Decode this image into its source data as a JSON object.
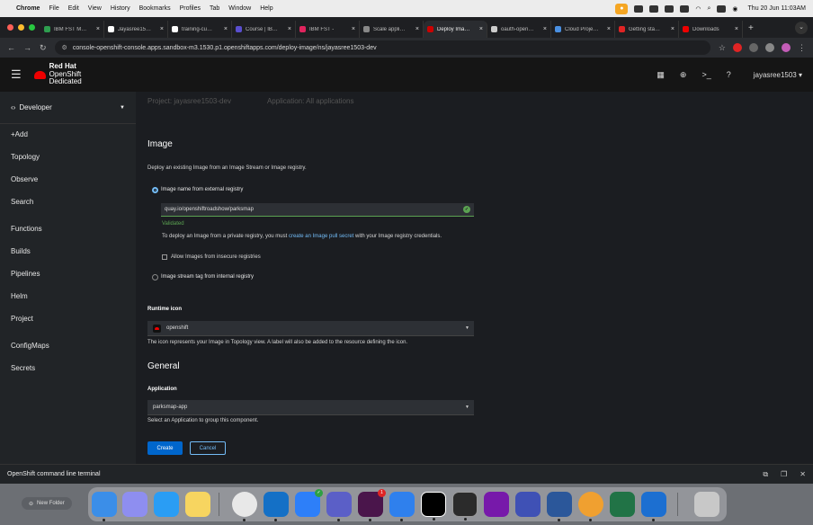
{
  "menubar": {
    "app": "Chrome",
    "items": [
      "File",
      "Edit",
      "View",
      "History",
      "Bookmarks",
      "Profiles",
      "Tab",
      "Window",
      "Help"
    ],
    "clock": "Thu 20 Jun  11:03AM"
  },
  "tabs": [
    {
      "label": "IBM FST M…",
      "color": "#2e9e4f"
    },
    {
      "label": "Jayasree15…",
      "color": "#ffffff"
    },
    {
      "label": "training-cu…",
      "color": "#ffffff"
    },
    {
      "label": "Course | IB…",
      "color": "#5a4fcf"
    },
    {
      "label": "IBM FST -",
      "color": "#e0245e"
    },
    {
      "label": "Scale appli…",
      "color": "#888888"
    },
    {
      "label": "Deploy Ima…",
      "color": "#cc0000",
      "active": true
    },
    {
      "label": "oauth-open…",
      "color": "#cccccc"
    },
    {
      "label": "Cloud Proje…",
      "color": "#4a90e2"
    },
    {
      "label": "Getting sta…",
      "color": "#e02424"
    },
    {
      "label": "Downloads",
      "color": "#ee0000"
    }
  ],
  "address": {
    "url": "console-openshift-console.apps.sandbox-m3.1530.p1.openshiftapps.com/deploy-image/ns/jayasree1503-dev"
  },
  "masthead": {
    "brand_line1": "Red Hat",
    "brand_line2": "OpenShift",
    "brand_line3": "Dedicated",
    "user": "jayasree1503 ▾"
  },
  "sidebar": {
    "perspective": "Developer",
    "items": [
      "+Add",
      "Topology",
      "Observe",
      "Search",
      "Functions",
      "Builds",
      "Pipelines",
      "Helm",
      "Project",
      "ConfigMaps",
      "Secrets"
    ]
  },
  "context": {
    "project": "Project: jayasree1503-dev",
    "application": "Application: All applications"
  },
  "form": {
    "image_heading": "Image",
    "image_desc": "Deploy an existing Image from an Image Stream or Image registry.",
    "radio_external": "Image name from external registry",
    "image_value": "quay.io/openshiftroadshow/parksmap",
    "validated": "Validated",
    "private_pre": "To deploy an Image from a private registry, you must ",
    "private_link": "create an Image pull secret",
    "private_post": " with your Image registry credentials.",
    "insecure_label": "Allow Images from insecure registries",
    "radio_internal": "Image stream tag from internal registry",
    "runtime_label": "Runtime icon",
    "runtime_value": "openshift",
    "runtime_help": "The icon represents your Image in Topology view. A label will also be added to the resource defining the icon.",
    "general_heading": "General",
    "application_label": "Application",
    "application_value": "parksmap-app",
    "application_help": "Select an Application to group this component.",
    "create": "Create",
    "cancel": "Cancel"
  },
  "terminal": {
    "label": "OpenShift command line terminal"
  },
  "desktop": {
    "new_folder": "New Folder"
  },
  "colors": {
    "accent": "#73bcf7",
    "primary_button": "#0066cc",
    "success": "#5ba352",
    "brand_red": "#ee0000"
  }
}
